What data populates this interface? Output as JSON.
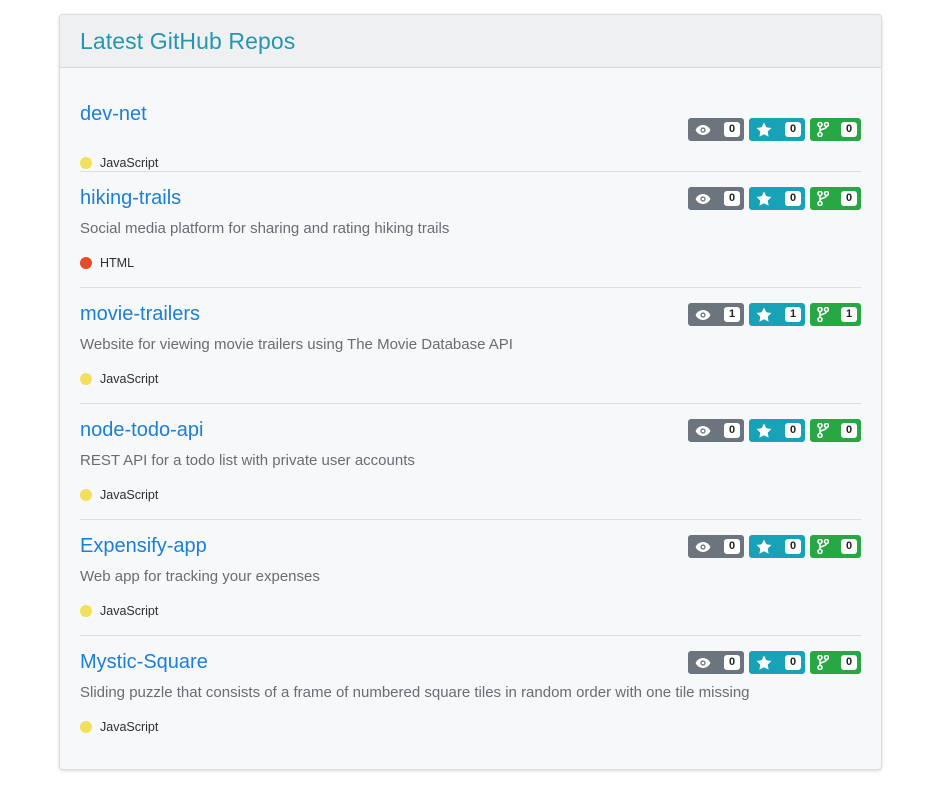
{
  "header": {
    "title": "Latest GitHub Repos"
  },
  "colors": {
    "watch_badge": "#6c757d",
    "star_badge": "#17a2b8",
    "fork_badge": "#28a745",
    "javascript": "#f1e05a",
    "html": "#e34c26"
  },
  "repos": [
    {
      "name": "dev-net",
      "description": "",
      "language": "JavaScript",
      "language_color": "#f1e05a",
      "watchers": "0",
      "stars": "0",
      "forks": "0"
    },
    {
      "name": "hiking-trails",
      "description": "Social media platform for sharing and rating hiking trails",
      "language": "HTML",
      "language_color": "#e34c26",
      "watchers": "0",
      "stars": "0",
      "forks": "0"
    },
    {
      "name": "movie-trailers",
      "description": "Website for viewing movie trailers using The Movie Database API",
      "language": "JavaScript",
      "language_color": "#f1e05a",
      "watchers": "1",
      "stars": "1",
      "forks": "1"
    },
    {
      "name": "node-todo-api",
      "description": "REST API for a todo list with private user accounts",
      "language": "JavaScript",
      "language_color": "#f1e05a",
      "watchers": "0",
      "stars": "0",
      "forks": "0"
    },
    {
      "name": "Expensify-app",
      "description": "Web app for tracking your expenses",
      "language": "JavaScript",
      "language_color": "#f1e05a",
      "watchers": "0",
      "stars": "0",
      "forks": "0"
    },
    {
      "name": "Mystic-Square",
      "description": "Sliding puzzle that consists of a frame of numbered square tiles in random order with one tile missing",
      "language": "JavaScript",
      "language_color": "#f1e05a",
      "watchers": "0",
      "stars": "0",
      "forks": "0"
    }
  ]
}
